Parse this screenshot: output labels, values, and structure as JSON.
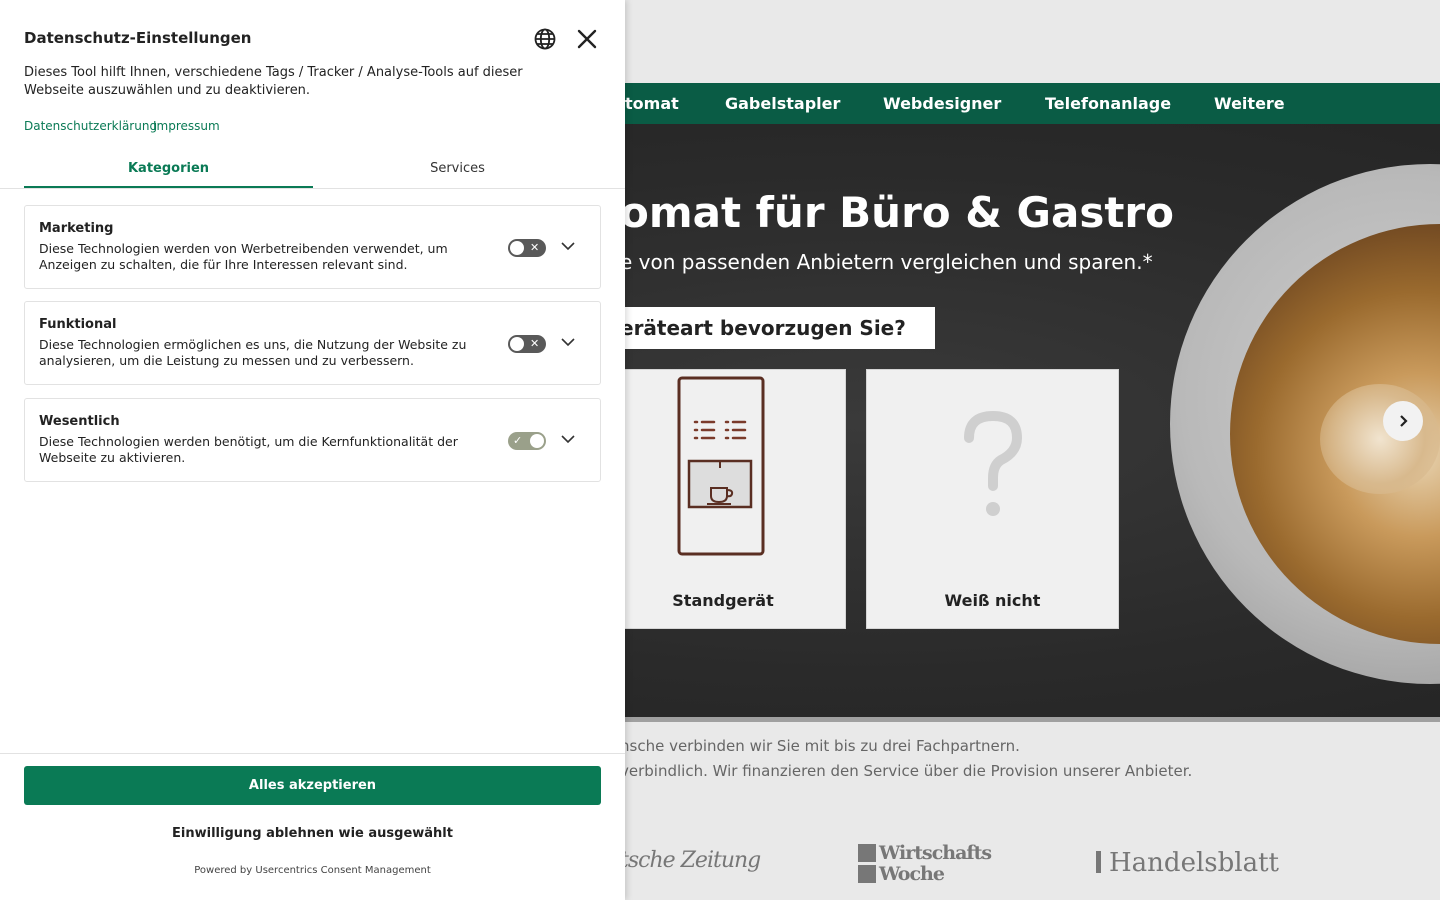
{
  "background": {
    "nav": [
      "tomat",
      "Gabelstapler",
      "Webdesigner",
      "Telefonanlage",
      "Weitere"
    ],
    "hero_title": "omat für Büro & Gastro",
    "hero_subtitle": "e von passenden Anbietern vergleichen und sparen.*",
    "question": "eräteart bevorzugen Sie?",
    "cards": [
      {
        "label": "Standgerät",
        "icon": "coffee-machine-icon"
      },
      {
        "label": "Weiß nicht",
        "icon": "question-mark-icon"
      }
    ],
    "next_icon": "chevron-right-icon",
    "info_lines": [
      "nsche verbinden wir Sie mit bis zu drei Fachpartnern.",
      "verbindlich. Wir finanzieren den Service über die Provision unserer Anbieter."
    ],
    "press": [
      "tsche Zeitung",
      "Wirtschafts",
      "Woche",
      "Handelsblatt"
    ]
  },
  "panel": {
    "title": "Datenschutz-Einstellungen",
    "language_icon": "globe-icon",
    "close_icon": "close-icon",
    "description": "Dieses Tool hilft Ihnen, verschiedene Tags / Tracker / Analyse-Tools auf dieser Webseite auszuwählen und zu deaktivieren.",
    "links": [
      "Datenschutzerklärung",
      "Impressum"
    ],
    "tabs": [
      {
        "label": "Kategorien",
        "active": true
      },
      {
        "label": "Services",
        "active": false
      }
    ],
    "categories": [
      {
        "title": "Marketing",
        "description": "Diese Technologien werden von Werbetreibenden verwendet, um Anzeigen zu schalten, die für Ihre Interessen relevant sind.",
        "enabled": false
      },
      {
        "title": "Funktional",
        "description": "Diese Technologien ermöglichen es uns, die Nutzung der Website zu analysieren, um die Leistung zu messen und zu verbessern.",
        "enabled": false
      },
      {
        "title": "Wesentlich",
        "description": "Diese Technologien werden benötigt, um die Kernfunktionalität der Webseite zu aktivieren.",
        "enabled": true
      }
    ],
    "accept_label": "Alles akzeptieren",
    "deny_label": "Einwilligung ablehnen wie ausgewählt",
    "powered_by": "Powered by Usercentrics Consent Management"
  },
  "colors": {
    "brand_green": "#0a7a55",
    "nav_green": "#0a5c45"
  }
}
